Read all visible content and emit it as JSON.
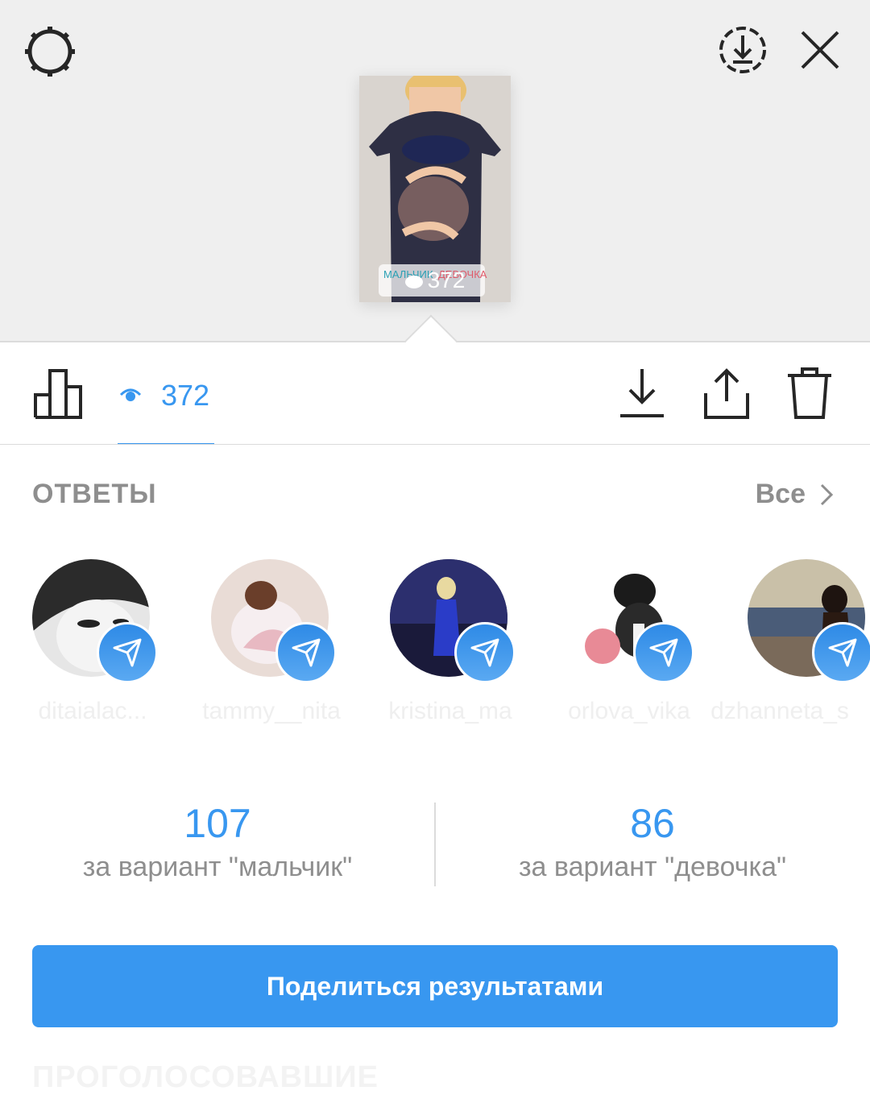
{
  "story": {
    "views": "372",
    "poll_left": "МАЛЬЧИК",
    "poll_right": "ДЕВОЧКА"
  },
  "toolbar": {
    "views_count": "372"
  },
  "answers": {
    "title": "ОТВЕТЫ",
    "see_all": "Все",
    "responders": [
      {
        "name": "ditaialac..."
      },
      {
        "name": "tammy__nita"
      },
      {
        "name": "kristina_ma"
      },
      {
        "name": "orlova_vika"
      },
      {
        "name": "dzhanneta_s"
      }
    ]
  },
  "results": {
    "option1": {
      "count": "107",
      "label": "за вариант \"мальчик\""
    },
    "option2": {
      "count": "86",
      "label": "за вариант \"девочка\""
    }
  },
  "share_button": "Поделиться результатами",
  "voters_heading": "ПРОГОЛОСОВАВШИЕ",
  "colors": {
    "accent": "#3897f0",
    "muted": "#8e8e8e",
    "top_bg": "#efefef"
  }
}
